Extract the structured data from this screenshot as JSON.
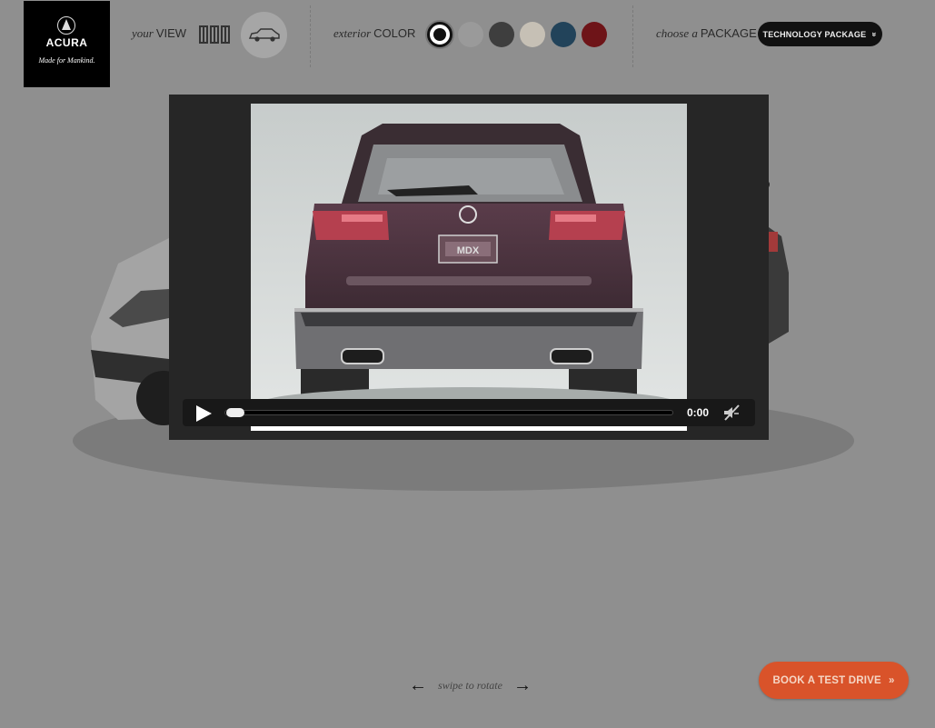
{
  "brand": {
    "name": "ACURA",
    "tagline": "Made for Mankind."
  },
  "view": {
    "prefix": "your",
    "label": "VIEW"
  },
  "color": {
    "prefix": "exterior",
    "label": "COLOR",
    "swatches": [
      {
        "name": "white",
        "hex": "#ffffff",
        "selected": true
      },
      {
        "name": "silver",
        "hex": "#9a9a9a",
        "selected": false
      },
      {
        "name": "graphite",
        "hex": "#3e3e3e",
        "selected": false
      },
      {
        "name": "champagne",
        "hex": "#c6c0b5",
        "selected": false
      },
      {
        "name": "blue",
        "hex": "#22435a",
        "selected": false
      },
      {
        "name": "red",
        "hex": "#6e1418",
        "selected": false
      }
    ]
  },
  "package": {
    "prefix": "choose a",
    "label": "PACKAGE",
    "selected": "TECHNOLOGY PACKAGE",
    "chevron": "»"
  },
  "video": {
    "time": "0:00",
    "progress": 0,
    "plate": "MDX"
  },
  "rotate": {
    "label": "swipe to rotate",
    "left_arrow": "←",
    "right_arrow": "→"
  },
  "cta": {
    "label": "BOOK A TEST DRIVE",
    "chevron": "»",
    "color": "#d9532a"
  }
}
